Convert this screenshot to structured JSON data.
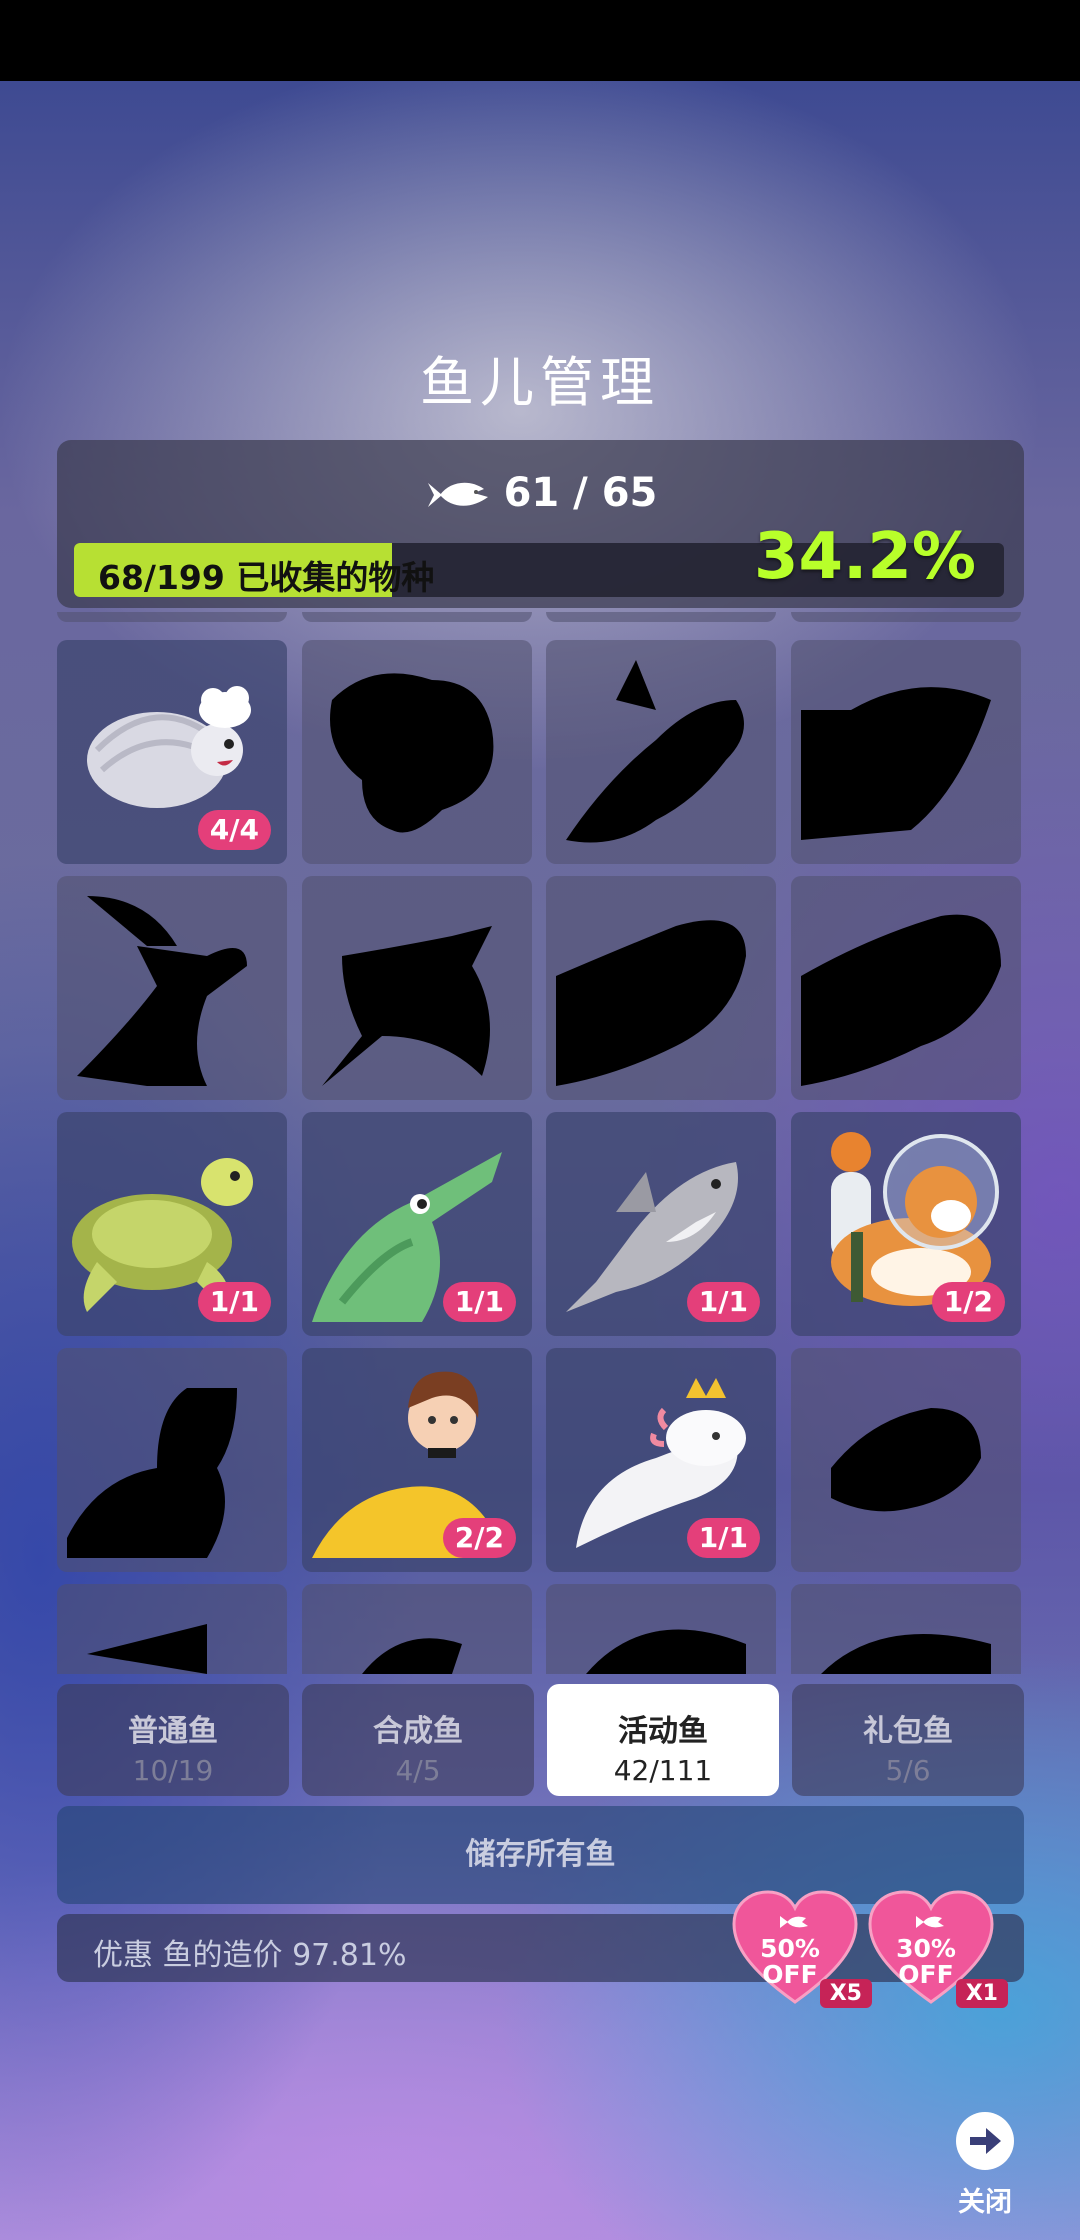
{
  "title": "鱼儿管理",
  "fish_count": "61 / 65",
  "progress": {
    "label": "68/199 已收集的物种",
    "percent_text": "34.2%",
    "fraction": 0.342
  },
  "fish_tiles": [
    {
      "name": "isopod-chef",
      "revealed": true,
      "count": "4/4"
    },
    {
      "name": "silhouette-2",
      "revealed": false
    },
    {
      "name": "silhouette-3",
      "revealed": false
    },
    {
      "name": "silhouette-4",
      "revealed": false
    },
    {
      "name": "silhouette-5",
      "revealed": false
    },
    {
      "name": "silhouette-6",
      "revealed": false
    },
    {
      "name": "silhouette-7",
      "revealed": false
    },
    {
      "name": "silhouette-8",
      "revealed": false
    },
    {
      "name": "sea-turtle",
      "revealed": true,
      "count": "1/1"
    },
    {
      "name": "crocodile",
      "revealed": true,
      "count": "1/1"
    },
    {
      "name": "shark",
      "revealed": true,
      "count": "1/1"
    },
    {
      "name": "corgi-astronaut",
      "revealed": true,
      "count": "1/2"
    },
    {
      "name": "silhouette-13",
      "revealed": false
    },
    {
      "name": "mermaid",
      "revealed": true,
      "count": "2/2"
    },
    {
      "name": "axolotl-king",
      "revealed": true,
      "count": "1/1"
    },
    {
      "name": "silhouette-16",
      "revealed": false
    }
  ],
  "tabs": [
    {
      "label": "普通鱼",
      "count": "10/19",
      "active": false
    },
    {
      "label": "合成鱼",
      "count": "4/5",
      "active": false
    },
    {
      "label": "活动鱼",
      "count": "42/111",
      "active": true
    },
    {
      "label": "礼包鱼",
      "count": "5/6",
      "active": false
    }
  ],
  "store_button": "储存所有鱼",
  "discount_text": "优惠 鱼的造价 97.81%",
  "offers": [
    {
      "percent": "50%",
      "off": "OFF",
      "multiplier": "X5"
    },
    {
      "percent": "30%",
      "off": "OFF",
      "multiplier": "X1"
    }
  ],
  "close_label": "关闭",
  "colors": {
    "badge": "#e43f7a",
    "progress_fill": "#b7e033",
    "percent_text": "#b8ff2a",
    "heart": "#f0569a"
  }
}
